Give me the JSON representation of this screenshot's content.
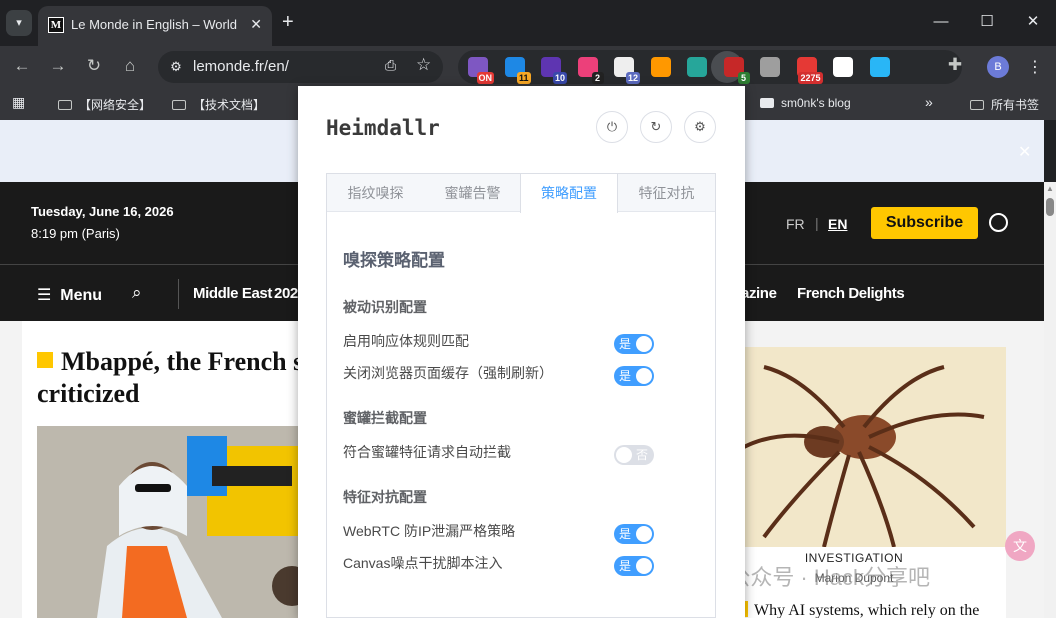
{
  "browser": {
    "tab": {
      "title": "Le Monde in English – World",
      "favicon": "M"
    },
    "url": "lemonde.fr/en/",
    "profile_initial": "B",
    "extensions": [
      {
        "name": "on-ext",
        "badge": "ON",
        "badge_color": "#e53935",
        "color": "#7e57c2"
      },
      {
        "name": "c-ext",
        "badge": "11",
        "badge_color": "#f9a825",
        "color": "#1e88e5"
      },
      {
        "name": "shield-ext",
        "badge": "10",
        "badge_color": "#3949ab",
        "color": "#5e35b1"
      },
      {
        "name": "dots-ext",
        "badge": "2",
        "badge_color": "#222222",
        "color": "#ec407a"
      },
      {
        "name": "calendar-ext",
        "badge": "12",
        "badge_color": "#5c6bc0",
        "color": "#eeeeee"
      },
      {
        "name": "person-ext",
        "badge": "",
        "badge_color": "",
        "color": "#ff9800"
      },
      {
        "name": "code-ext",
        "badge": "",
        "badge_color": "",
        "color": "#26a69a"
      },
      {
        "name": "heimdallr-ext",
        "badge": "5",
        "badge_color": "#2e7d32",
        "color": "#c62828"
      },
      {
        "name": "pause-ext",
        "badge": "",
        "badge_color": "",
        "color": "#9e9e9e"
      },
      {
        "name": "counter-ext",
        "badge": "2275",
        "badge_color": "#d32f2f",
        "color": "#e53935"
      },
      {
        "name": "panda-ext",
        "badge": "",
        "badge_color": "",
        "color": "#ffffff"
      },
      {
        "name": "diamond-ext",
        "badge": "",
        "badge_color": "",
        "color": "#29b6f6"
      }
    ]
  },
  "bookmarks": {
    "items": [
      "【网络安全】",
      "【技术文档】",
      "sm0nk's blog"
    ],
    "overflow": "»",
    "all": "所有书签"
  },
  "lemonde": {
    "date": "Tuesday, June 16, 2026",
    "time": "8:19 pm (Paris)",
    "lang_fr": "FR",
    "lang_en": "EN",
    "subscribe": "Subscribe",
    "menu": "Menu",
    "nav": [
      "Middle East",
      "202",
      "azine",
      "French Delights"
    ],
    "headline": "Mbappé, the French star adored and criticized",
    "side_kicker": "INVESTIGATION",
    "side_author": "Marion Dupont",
    "side_headline": "Why AI systems, which rely on the internet, poorly reflect the"
  },
  "watermark": "公众号 · Hack分享吧",
  "popup": {
    "title": "Heimdallr",
    "tabs": [
      "指纹嗅探",
      "蜜罐告警",
      "策略配置",
      "特征对抗"
    ],
    "active_tab": 2,
    "heading": "嗅探策略配置",
    "sections": [
      {
        "title": "被动识别配置",
        "rows": [
          {
            "label": "启用响应体规则匹配",
            "state": "是",
            "on": true
          },
          {
            "label": "关闭浏览器页面缓存（强制刷新）",
            "state": "是",
            "on": true
          }
        ]
      },
      {
        "title": "蜜罐拦截配置",
        "rows": [
          {
            "label": "符合蜜罐特征请求自动拦截",
            "state": "否",
            "on": false
          }
        ]
      },
      {
        "title": "特征对抗配置",
        "rows": [
          {
            "label": "WebRTC 防IP泄漏严格策略",
            "state": "是",
            "on": true
          },
          {
            "label": "Canvas噪点干扰脚本注入",
            "state": "是",
            "on": true
          }
        ]
      }
    ],
    "accent": "#409eff"
  }
}
